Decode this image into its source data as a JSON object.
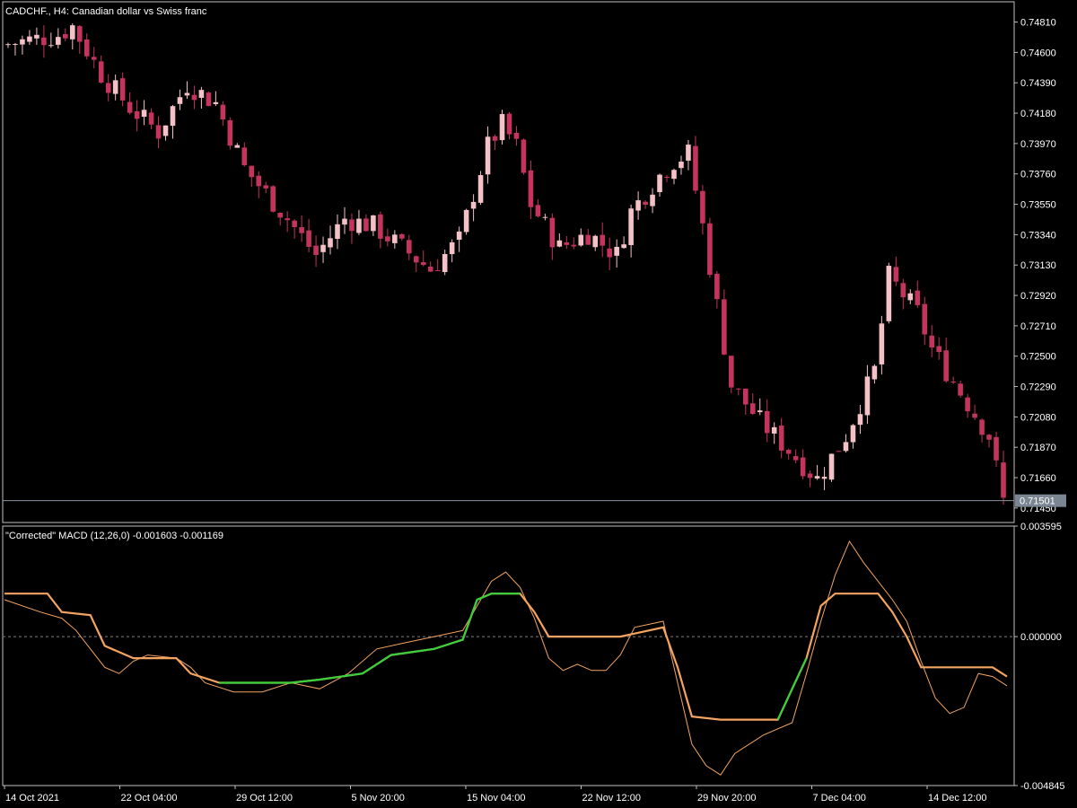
{
  "colors": {
    "background": "#000000",
    "frame": "#c0c0c0",
    "bull_candle": "#f4c2c6",
    "bear_candle": "#c4345c",
    "bid_line": "#8a94a0",
    "bid_label_bg": "#7a8694",
    "signal_line": "#f4a460",
    "macd_line": "#3ad03a",
    "thin_macd": "#3ad03a",
    "thin_signal": "#f4a460",
    "zero_line": "#808080"
  },
  "chart_data": [
    {
      "type": "candlestick",
      "title": "CADCHF., H4:  Canadian dollar vs Swiss franc",
      "ylim": [
        0.7135,
        0.7495
      ],
      "y_ticks": [
        "0.74810",
        "0.74600",
        "0.74390",
        "0.74180",
        "0.73970",
        "0.73760",
        "0.73550",
        "0.73340",
        "0.73130",
        "0.72920",
        "0.72710",
        "0.72500",
        "0.72290",
        "0.72080",
        "0.71870",
        "0.71660",
        "0.71450"
      ],
      "current_price": "0.71501",
      "current_price_value": 0.71501,
      "candle_count": 140,
      "key_levels": [
        [
          0,
          0.7465
        ],
        [
          8,
          0.7472
        ],
        [
          10,
          0.7478
        ],
        [
          14,
          0.7445
        ],
        [
          18,
          0.7422
        ],
        [
          22,
          0.7405
        ],
        [
          26,
          0.7438
        ],
        [
          30,
          0.7425
        ],
        [
          34,
          0.738
        ],
        [
          40,
          0.7345
        ],
        [
          44,
          0.732
        ],
        [
          48,
          0.7345
        ],
        [
          52,
          0.734
        ],
        [
          56,
          0.7325
        ],
        [
          60,
          0.731
        ],
        [
          64,
          0.733
        ],
        [
          68,
          0.7395
        ],
        [
          70,
          0.741
        ],
        [
          72,
          0.7395
        ],
        [
          74,
          0.7355
        ],
        [
          78,
          0.7325
        ],
        [
          82,
          0.7335
        ],
        [
          86,
          0.732
        ],
        [
          88,
          0.735
        ],
        [
          92,
          0.7375
        ],
        [
          94,
          0.7385
        ],
        [
          96,
          0.739
        ],
        [
          98,
          0.734
        ],
        [
          102,
          0.723
        ],
        [
          106,
          0.7205
        ],
        [
          110,
          0.7185
        ],
        [
          114,
          0.7165
        ],
        [
          118,
          0.7195
        ],
        [
          122,
          0.724
        ],
        [
          124,
          0.7305
        ],
        [
          128,
          0.728
        ],
        [
          130,
          0.7255
        ],
        [
          134,
          0.7225
        ],
        [
          138,
          0.7195
        ],
        [
          140,
          0.715
        ]
      ],
      "x_ticks": [
        "14 Oct 2021",
        "22 Oct 04:00",
        "29 Oct 12:00",
        "5 Nov 20:00",
        "15 Nov 04:00",
        "22 Nov 12:00",
        "29 Nov 20:00",
        "7 Dec 04:00",
        "14 Dec 12:00"
      ]
    },
    {
      "type": "line",
      "title": "\"Corrected\" MACD (12,26,0) -0.001603 -0.001169",
      "ylim": [
        -0.004845,
        0.003595
      ],
      "y_ticks": [
        "0.003595",
        "0.000000",
        "-0.004845"
      ],
      "zero_line": 0,
      "series": [
        {
          "name": "MACD",
          "points": [
            [
              0,
              0.0012
            ],
            [
              5,
              0.0008
            ],
            [
              8,
              0.0006
            ],
            [
              10,
              0.0002
            ],
            [
              12,
              -0.0004
            ],
            [
              14,
              -0.001
            ],
            [
              16,
              -0.0012
            ],
            [
              18,
              -0.0008
            ],
            [
              20,
              -0.0006
            ],
            [
              24,
              -0.0007
            ],
            [
              26,
              -0.001
            ],
            [
              28,
              -0.0015
            ],
            [
              32,
              -0.0018
            ],
            [
              36,
              -0.0018
            ],
            [
              40,
              -0.0015
            ],
            [
              44,
              -0.0017
            ],
            [
              48,
              -0.0012
            ],
            [
              52,
              -0.0004
            ],
            [
              56,
              -0.0002
            ],
            [
              60,
              0.0
            ],
            [
              64,
              0.0002
            ],
            [
              66,
              0.001
            ],
            [
              68,
              0.0018
            ],
            [
              70,
              0.0021
            ],
            [
              72,
              0.0016
            ],
            [
              74,
              0.0006
            ],
            [
              76,
              -0.0007
            ],
            [
              78,
              -0.0011
            ],
            [
              80,
              -0.0009
            ],
            [
              82,
              -0.0011
            ],
            [
              84,
              -0.0011
            ],
            [
              86,
              -0.0006
            ],
            [
              88,
              0.0003
            ],
            [
              90,
              0.0004
            ],
            [
              92,
              0.0005
            ],
            [
              94,
              -0.0015
            ],
            [
              96,
              -0.0035
            ],
            [
              98,
              -0.0042
            ],
            [
              100,
              -0.0045
            ],
            [
              102,
              -0.0038
            ],
            [
              106,
              -0.0032
            ],
            [
              110,
              -0.0028
            ],
            [
              112,
              -0.0012
            ],
            [
              114,
              0.0005
            ],
            [
              116,
              0.002
            ],
            [
              118,
              0.0031
            ],
            [
              120,
              0.0024
            ],
            [
              124,
              0.0012
            ],
            [
              126,
              0.0005
            ],
            [
              128,
              -0.0008
            ],
            [
              130,
              -0.002
            ],
            [
              132,
              -0.0025
            ],
            [
              134,
              -0.0023
            ],
            [
              136,
              -0.0012
            ],
            [
              138,
              -0.0013
            ],
            [
              140,
              -0.0016
            ]
          ]
        },
        {
          "name": "Signal",
          "points": [
            [
              0,
              0.0014
            ],
            [
              6,
              0.0014
            ],
            [
              8,
              0.0008
            ],
            [
              12,
              0.0007
            ],
            [
              14,
              -0.0003
            ],
            [
              18,
              -0.0007
            ],
            [
              24,
              -0.0007
            ],
            [
              26,
              -0.0012
            ],
            [
              30,
              -0.0015
            ],
            [
              40,
              -0.0015
            ],
            [
              44,
              -0.0014
            ],
            [
              50,
              -0.0012
            ],
            [
              54,
              -0.0006
            ],
            [
              60,
              -0.0004
            ],
            [
              64,
              -0.0001
            ],
            [
              66,
              0.0012
            ],
            [
              68,
              0.0014
            ],
            [
              72,
              0.0014
            ],
            [
              74,
              0.0008
            ],
            [
              76,
              0.0
            ],
            [
              86,
              0.0
            ],
            [
              88,
              0.0001
            ],
            [
              92,
              0.0003
            ],
            [
              94,
              -0.001
            ],
            [
              96,
              -0.0026
            ],
            [
              100,
              -0.0027
            ],
            [
              108,
              -0.0027
            ],
            [
              110,
              -0.0017
            ],
            [
              112,
              -0.0007
            ],
            [
              114,
              0.001
            ],
            [
              116,
              0.0014
            ],
            [
              122,
              0.0014
            ],
            [
              124,
              0.0008
            ],
            [
              126,
              0.0
            ],
            [
              128,
              -0.001
            ],
            [
              134,
              -0.001
            ],
            [
              138,
              -0.001
            ],
            [
              140,
              -0.0013
            ]
          ]
        }
      ]
    }
  ]
}
